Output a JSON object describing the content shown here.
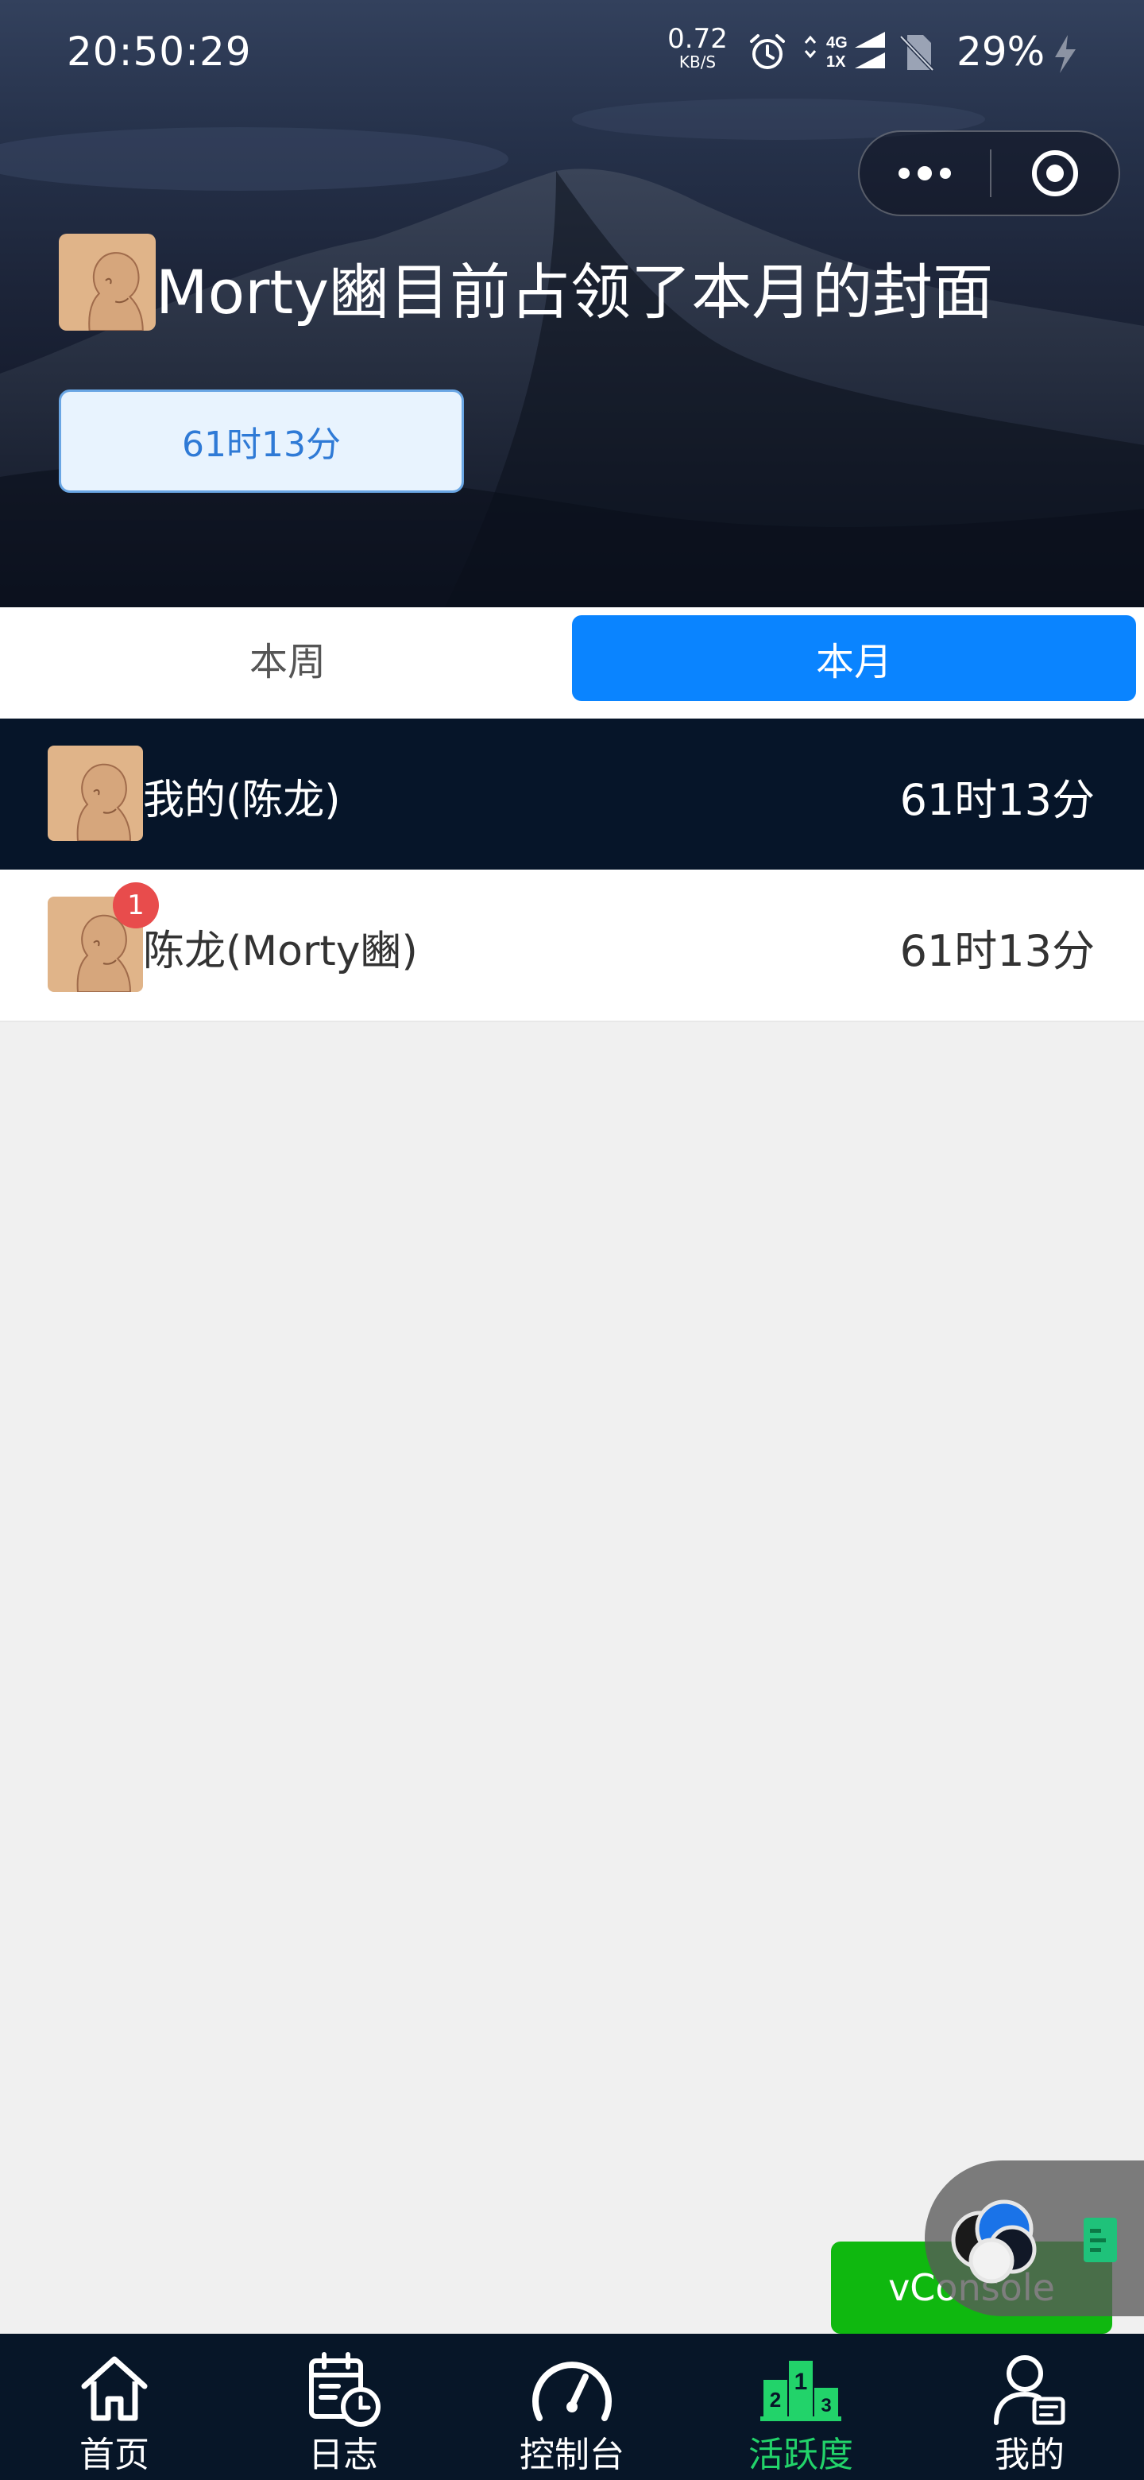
{
  "status_bar": {
    "time": "20:50:29",
    "net_speed_value": "0.72",
    "net_speed_unit": "KB/S",
    "signal_top": "4G",
    "signal_bottom": "1X",
    "battery": "29%",
    "icons": [
      "alarm-icon",
      "signal-icon",
      "no-sim-icon",
      "charging-icon"
    ]
  },
  "capsule": {
    "more_icon": "more-dots-icon",
    "close_icon": "target-icon"
  },
  "cover": {
    "title": "Morty豳目前占领了本月的封面",
    "duration": "61时13分"
  },
  "tabs": [
    {
      "label": "本周",
      "active": false
    },
    {
      "label": "本月",
      "active": true
    }
  ],
  "my_row": {
    "name": "我的(陈龙)",
    "value": "61时13分"
  },
  "ranking": [
    {
      "rank": "1",
      "name": "陈龙(Morty豳)",
      "value": "61时13分"
    }
  ],
  "vconsole": {
    "label": "vConsole"
  },
  "nav": [
    {
      "label": "首页",
      "icon": "home-icon",
      "active": false
    },
    {
      "label": "日志",
      "icon": "calendar-clock-icon",
      "active": false
    },
    {
      "label": "控制台",
      "icon": "speedometer-icon",
      "active": false
    },
    {
      "label": "活跃度",
      "icon": "podium-icon",
      "active": true
    },
    {
      "label": "我的",
      "icon": "profile-icon",
      "active": false
    }
  ],
  "colors": {
    "accent": "#0a84ff",
    "active_nav": "#22d36a",
    "dark_row": "#061529",
    "badge": "#e84c4c",
    "vconsole": "#0fb80f"
  }
}
